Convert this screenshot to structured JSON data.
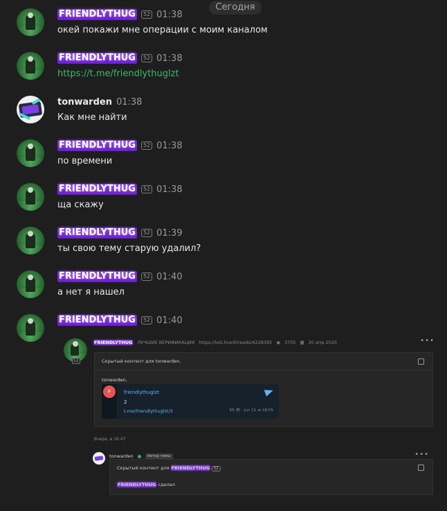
{
  "date_separator": "Сегодня",
  "messages": [
    {
      "author": "FRIENDLYTHUG",
      "level": "52",
      "time": "01:38",
      "text": "окей покажи мне операции с моим каналом"
    },
    {
      "author": "FRIENDLYTHUG",
      "level": "52",
      "time": "01:38",
      "text": "https://t.me/friendlythuglzt"
    },
    {
      "author": "tonwarden",
      "time": "01:38",
      "text": "Как мне найти"
    },
    {
      "author": "FRIENDLYTHUG",
      "level": "52",
      "time": "01:38",
      "text": "по времени"
    },
    {
      "author": "FRIENDLYTHUG",
      "level": "52",
      "time": "01:38",
      "text": "ща скажу"
    },
    {
      "author": "FRIENDLYTHUG",
      "level": "52",
      "time": "01:39",
      "text": "ты свою тему старую удалил?"
    },
    {
      "author": "FRIENDLYTHUG",
      "level": "52",
      "time": "01:40",
      "text": "а нет я нашел"
    },
    {
      "author": "FRIENDLYTHUG",
      "level": "52",
      "time": "01:40",
      "text": ""
    }
  ],
  "embed": {
    "author": "FRIENDLYTHUG",
    "level": "52",
    "section": "ЛУЧШИЕ ВЕРИФИКАЦИИ",
    "thread_url": "https://lolz.live/threads/4228395",
    "views": "3705",
    "date": "20 апр 2020",
    "hidden_label": "Скрытый контент для tonwarden.",
    "greeting": "tonwarden,",
    "tg_card": {
      "avatar_letter": "F",
      "channel": "friendlythuglzt",
      "post_text": "2",
      "post_link": "t.me/friendlythuglzt/3",
      "meta": "66 👁 · Jun 11 at 18:55"
    },
    "posted": "Вчера, в 16:47",
    "reply": {
      "author": "tonwarden",
      "badge": "Автор темы",
      "hidden_prefix": "Скрытый контент для",
      "hidden_user": "FRIENDLYTHUG",
      "hidden_level": "52",
      "mention": "FRIENDLYTHUG",
      "reply_text": "сделал"
    }
  }
}
